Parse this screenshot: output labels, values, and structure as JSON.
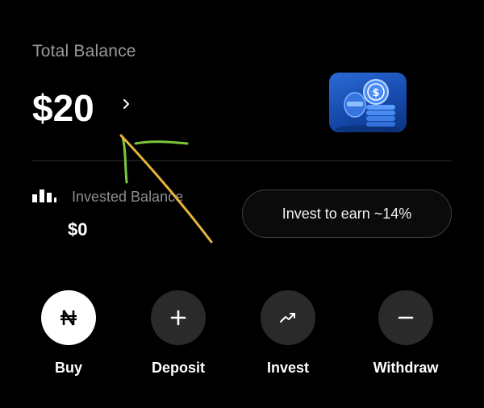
{
  "balance": {
    "total_label": "Total Balance",
    "total_amount": "$20",
    "invested_label": "Invested Balance",
    "invested_amount": "$0"
  },
  "promo": {
    "invest_cta": "Invest to earn ~14%"
  },
  "actions": [
    {
      "label": "Buy",
      "icon": "naira-icon"
    },
    {
      "label": "Deposit",
      "icon": "plus-icon"
    },
    {
      "label": "Invest",
      "icon": "trend-up-icon"
    },
    {
      "label": "Withdraw",
      "icon": "minus-icon"
    }
  ],
  "colors": {
    "background": "#000000",
    "muted_text": "#9a9a9a",
    "action_circle": "#2a2a2a",
    "tile_blue": "#1a55c0",
    "annotation_green": "#7bc83a",
    "annotation_yellow": "#e9b43b"
  }
}
